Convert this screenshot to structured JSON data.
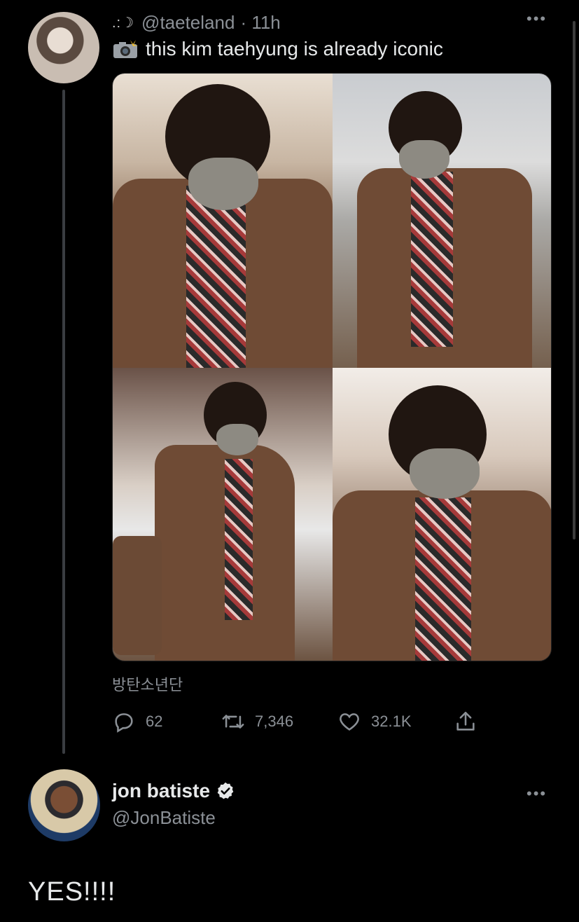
{
  "original_tweet": {
    "handle_prefix_emoji": ".:☽",
    "handle": "@taeteland",
    "time": "· 11h",
    "text": "this kim taehyung is already iconic",
    "caption": "방탄소년단",
    "stats": {
      "replies": "62",
      "retweets": "7,346",
      "likes": "32.1K"
    }
  },
  "reply_tweet": {
    "name": "jon batiste",
    "handle": "@JonBatiste",
    "text": "YES!!!!"
  },
  "icons": {
    "more": "more-horizontal-icon",
    "reply": "reply-icon",
    "retweet": "retweet-icon",
    "like": "heart-icon",
    "share": "share-icon",
    "verified": "verified-badge-icon",
    "camera": "camera-flash-icon"
  },
  "colors": {
    "background": "#000000",
    "secondary_text": "#8b9096",
    "primary_text": "#e7e9ea",
    "thread_line": "#3a3d41"
  }
}
